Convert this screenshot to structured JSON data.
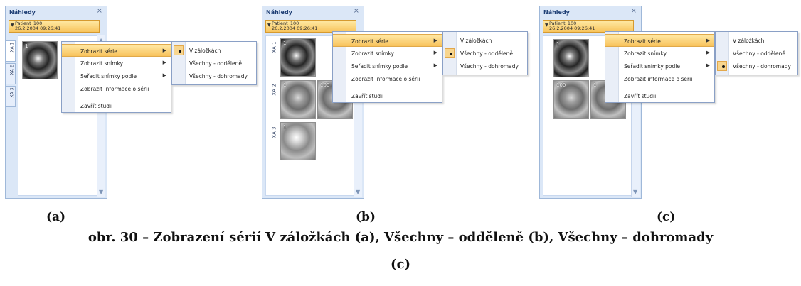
{
  "panel": {
    "title": "Náhledy",
    "close": "×",
    "patient_name": "Patient_100",
    "patient_date": "26.2.2004 09:26:41"
  },
  "tabs": [
    "XA 1",
    "XA 2",
    "XA 3"
  ],
  "thumbs": {
    "a1": "1",
    "b1": "1",
    "b2_left": "1",
    "b2_right": "100",
    "b3": "1",
    "c_top": "1",
    "c_left": "100",
    "c_right": "1"
  },
  "menu": {
    "items": [
      "Zobrazit série",
      "Zobrazit snímky",
      "Seřadit snímky podle",
      "Zobrazit informace o sérii",
      "Zavřít studii"
    ],
    "submenu": [
      "V záložkách",
      "Všechny - odděleně",
      "Všechny - dohromady"
    ]
  },
  "labels": {
    "a": "(a)",
    "b": "(b)",
    "c": "(c)"
  },
  "caption": {
    "line1": "obr. 30 – Zobrazení sérií V záložkách (a), Všechny – odděleně (b), Všechny – dohromady",
    "line2": "(c)"
  },
  "colors": {
    "panel_bg": "#dbe7f7",
    "highlight": "#f8c25b",
    "menu_border": "#8aa0c6"
  }
}
